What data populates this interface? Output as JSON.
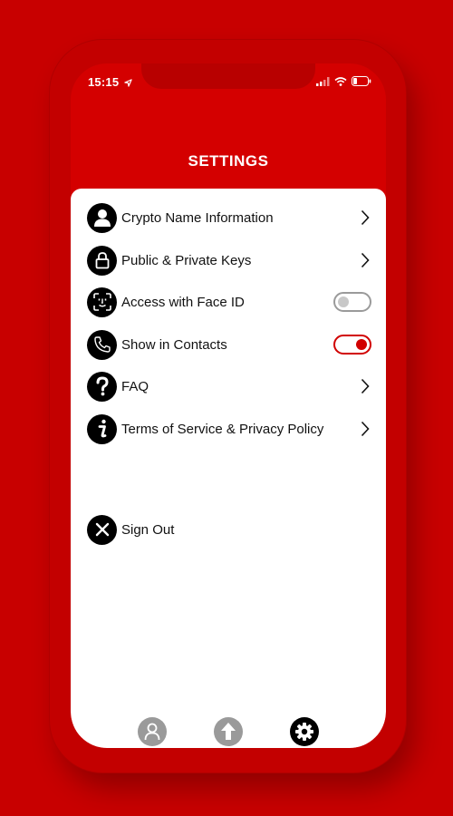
{
  "status": {
    "time": "15:15"
  },
  "header": {
    "title": "SETTINGS"
  },
  "settings": {
    "items": [
      {
        "label": "Crypto Name Information",
        "icon": "person-icon",
        "control": "chevron"
      },
      {
        "label": "Public & Private Keys",
        "icon": "lock-icon",
        "control": "chevron"
      },
      {
        "label": "Access with Face ID",
        "icon": "face-id-icon",
        "control": "toggle",
        "enabled": false
      },
      {
        "label": "Show in Contacts",
        "icon": "phone-icon",
        "control": "toggle",
        "enabled": true
      },
      {
        "label": "FAQ",
        "icon": "question-icon",
        "control": "chevron"
      },
      {
        "label": "Terms of Service & Privacy Policy",
        "icon": "info-icon",
        "control": "chevron"
      }
    ],
    "sign_out": {
      "label": "Sign Out",
      "icon": "close-icon"
    }
  },
  "tabbar": {
    "tabs": [
      {
        "name": "profile",
        "icon": "person-icon",
        "active": false
      },
      {
        "name": "upload",
        "icon": "arrow-up-icon",
        "active": false
      },
      {
        "name": "settings",
        "icon": "gear-icon",
        "active": true
      }
    ]
  },
  "colors": {
    "brand": "#d40000",
    "toggle_on": "#d10000"
  }
}
